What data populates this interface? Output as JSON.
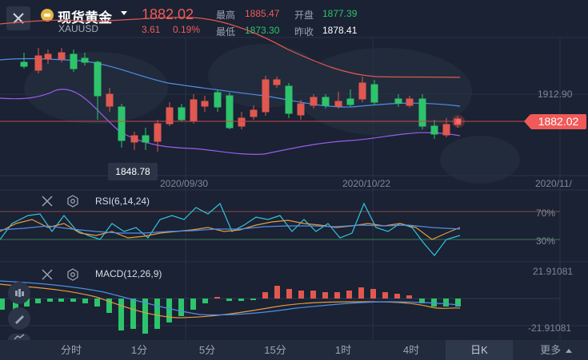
{
  "header": {
    "instrument_name": "现货黄金",
    "symbol": "XAUUSD",
    "price": "1882.02",
    "change": "3.61",
    "change_pct": "0.19%",
    "high_label": "最高",
    "high_value": "1885.47",
    "open_label": "开盘",
    "open_value": "1877.39",
    "low_label": "最低",
    "low_value": "1873.30",
    "prev_close_label": "昨收",
    "prev_close_value": "1878.41"
  },
  "main_chart": {
    "price_axis_label": "1912.90",
    "current_price_tag": "1882.02",
    "low_marker": "1848.78",
    "date_labels": [
      "2020/09/30",
      "2020/10/22",
      "2020/11/"
    ]
  },
  "rsi": {
    "title": "RSI(6,14,24)",
    "level_high": "70%",
    "level_low": "30%"
  },
  "macd": {
    "title": "MACD(12,26,9)",
    "axis_top": "21.91081",
    "axis_bottom": "-21.91081"
  },
  "timeframes": [
    "分时",
    "1分",
    "5分",
    "15分",
    "1时",
    "4时",
    "日K",
    "更多"
  ],
  "active_timeframe": "日K",
  "colors": {
    "up": "#f05a59",
    "down": "#2dc46b",
    "background": "#1a2233"
  }
}
